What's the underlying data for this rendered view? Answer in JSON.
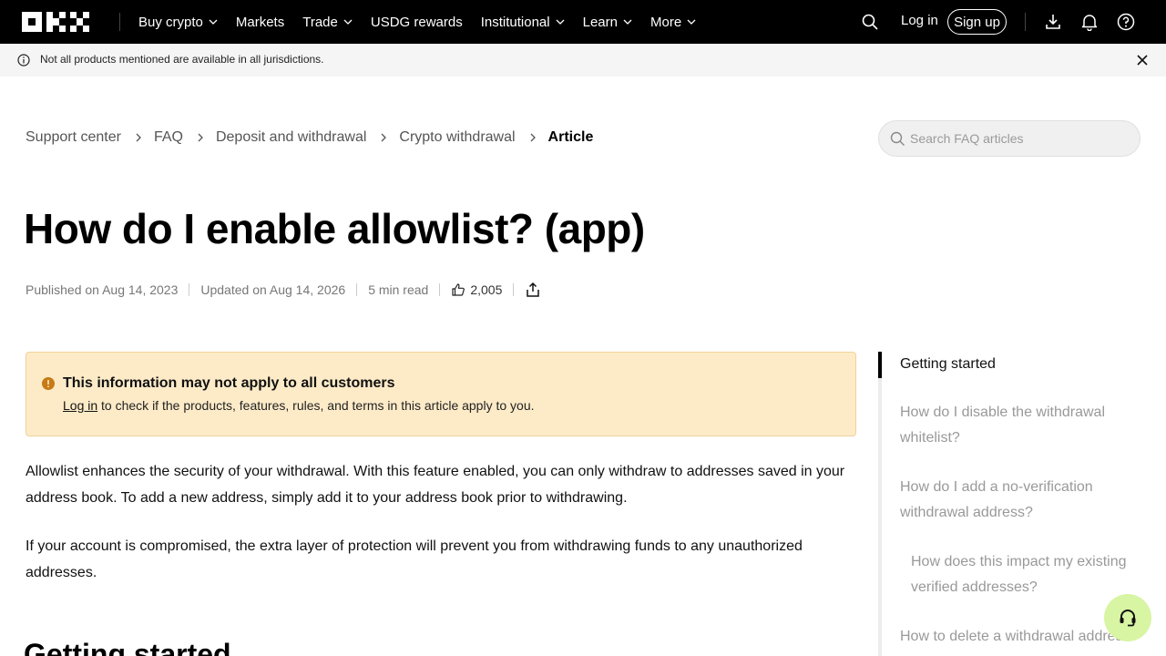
{
  "nav": {
    "logo": "OKX",
    "items": [
      {
        "label": "Buy crypto",
        "dropdown": true
      },
      {
        "label": "Markets",
        "dropdown": false
      },
      {
        "label": "Trade",
        "dropdown": true
      },
      {
        "label": "USDG rewards",
        "dropdown": false
      },
      {
        "label": "Institutional",
        "dropdown": true
      },
      {
        "label": "Learn",
        "dropdown": true
      },
      {
        "label": "More",
        "dropdown": true
      }
    ],
    "login": "Log in",
    "signup": "Sign up"
  },
  "notice": {
    "text": "Not all products mentioned are available in all jurisdictions."
  },
  "breadcrumb": {
    "items": [
      "Support center",
      "FAQ",
      "Deposit and withdrawal",
      "Crypto withdrawal"
    ],
    "current": "Article"
  },
  "faq_search": {
    "placeholder": "Search FAQ articles"
  },
  "article": {
    "title": "How do I enable allowlist? (app)",
    "published": "Published on Aug 14, 2023",
    "updated": "Updated on Aug 14, 2026",
    "read_time": "5 min read",
    "likes": "2,005",
    "callout": {
      "title": "This information may not apply to all customers",
      "link": "Log in",
      "body": " to check if the products, features, rules, and terms in this article apply to you."
    },
    "paragraphs": [
      "Allowlist enhances the security of your withdrawal. With this feature enabled, you can only withdraw to addresses saved in your address book. To add a new address, simply add it to your address book prior to withdrawing.",
      "If your account is compromised, the extra layer of protection will prevent you from withdrawing funds to any unauthorized addresses."
    ],
    "section_heading": "Getting started"
  },
  "toc": {
    "items": [
      {
        "label": "Getting started",
        "active": true,
        "indent": 0
      },
      {
        "label": "How do I disable the withdrawal whitelist?",
        "active": false,
        "indent": 0
      },
      {
        "label": "How do I add a no-verification withdrawal address?",
        "active": false,
        "indent": 0
      },
      {
        "label": "How does this impact my existing verified addresses?",
        "active": false,
        "indent": 1
      },
      {
        "label": "How to delete a withdrawal address",
        "active": false,
        "indent": 0
      }
    ]
  },
  "colors": {
    "navbar_bg": "#000000",
    "notice_bg": "#f5f5f5",
    "callout_bg": "#fdebc8",
    "callout_icon": "#c77b16",
    "support_bg": "#d8f5a3"
  },
  "icons": [
    "okx-logo",
    "chevron-down-icon",
    "search-icon",
    "download-icon",
    "bell-icon",
    "help-icon",
    "info-icon",
    "close-icon",
    "chevron-right-icon",
    "thumbs-up-icon",
    "share-icon",
    "alert-icon",
    "headset-icon"
  ]
}
